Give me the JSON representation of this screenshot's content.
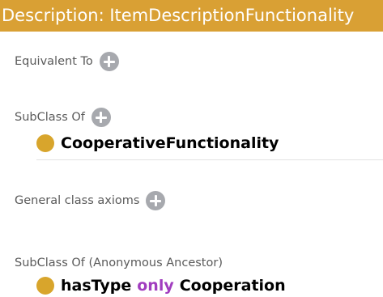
{
  "header": {
    "title": "Description: ItemDescriptionFunctionality"
  },
  "sections": {
    "equivalent_to": {
      "label": "Equivalent To"
    },
    "subclass_of": {
      "label": "SubClass Of",
      "items": [
        {
          "name": "CooperativeFunctionality"
        }
      ]
    },
    "general_class_axioms": {
      "label": "General class axioms"
    },
    "anonymous_ancestor": {
      "label": "SubClass Of (Anonymous Ancestor)",
      "items": [
        {
          "property": "hasType",
          "keyword": "only",
          "filler": "Cooperation"
        }
      ]
    }
  },
  "colors": {
    "header_bg": "#d9a034",
    "class_dot": "#d8a52c",
    "keyword": "#a13dbf",
    "add_button": "#a7a9ae"
  },
  "icons": {
    "add": "plus-circle-icon",
    "class": "class-dot-icon"
  }
}
